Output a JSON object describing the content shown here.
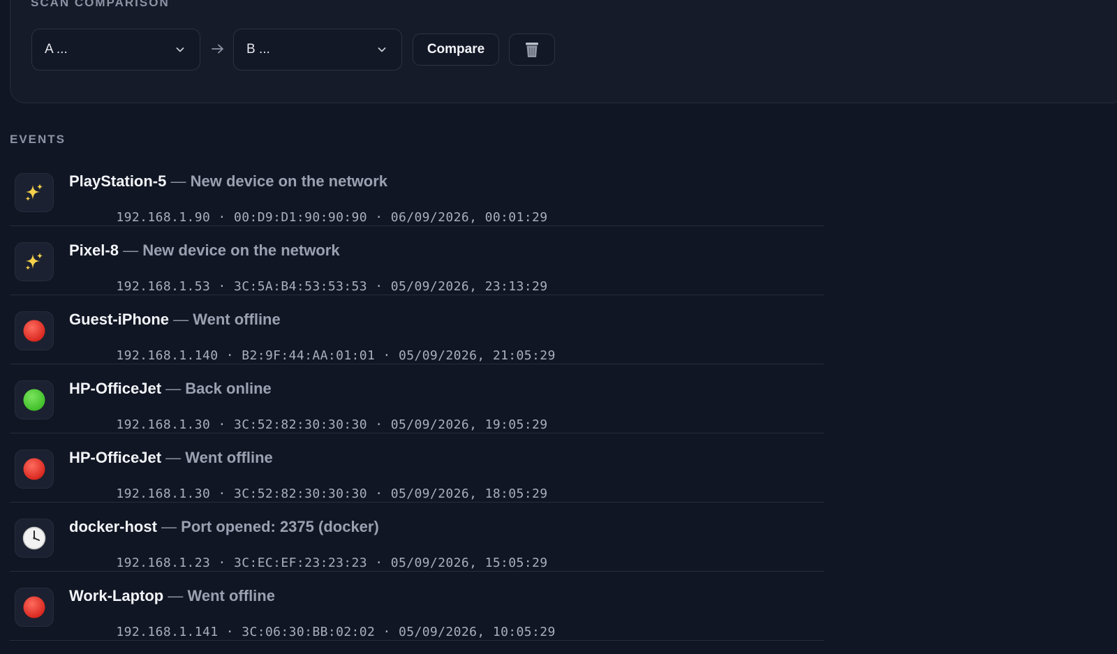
{
  "scan_comparison": {
    "title": "SCAN COMPARISON",
    "select_a": "A ...",
    "select_b": "B ...",
    "compare_label": "Compare"
  },
  "events": {
    "title": "EVENTS",
    "items": [
      {
        "icon": "sparkles-icon",
        "device": "PlayStation-5",
        "text": "New device on the network",
        "ip": "192.168.1.90",
        "mac": "00:D9:D1:90:90:90",
        "time": "06/09/2026, 00:01:29"
      },
      {
        "icon": "sparkles-icon",
        "device": "Pixel-8",
        "text": "New device on the network",
        "ip": "192.168.1.53",
        "mac": "3C:5A:B4:53:53:53",
        "time": "05/09/2026, 23:13:29"
      },
      {
        "icon": "red-circle-icon",
        "device": "Guest-iPhone",
        "text": "Went offline",
        "ip": "192.168.1.140",
        "mac": "B2:9F:44:AA:01:01",
        "time": "05/09/2026, 21:05:29"
      },
      {
        "icon": "green-circle-icon",
        "device": "HP-OfficeJet",
        "text": "Back online",
        "ip": "192.168.1.30",
        "mac": "3C:52:82:30:30:30",
        "time": "05/09/2026, 19:05:29"
      },
      {
        "icon": "red-circle-icon",
        "device": "HP-OfficeJet",
        "text": "Went offline",
        "ip": "192.168.1.30",
        "mac": "3C:52:82:30:30:30",
        "time": "05/09/2026, 18:05:29"
      },
      {
        "icon": "clock-icon",
        "device": "docker-host",
        "text": "Port opened: 2375 (docker)",
        "ip": "192.168.1.23",
        "mac": "3C:EC:EF:23:23:23",
        "time": "05/09/2026, 15:05:29"
      },
      {
        "icon": "red-circle-icon",
        "device": "Work-Laptop",
        "text": "Went offline",
        "ip": "192.168.1.141",
        "mac": "3C:06:30:BB:02:02",
        "time": "05/09/2026, 10:05:29"
      }
    ]
  },
  "colors": {
    "background": "#111624",
    "panel": "#161b29",
    "muted_text": "#9aa1b1",
    "offline": "#d7261e",
    "online": "#3fbf28",
    "sparkle": "#f5d04a"
  }
}
